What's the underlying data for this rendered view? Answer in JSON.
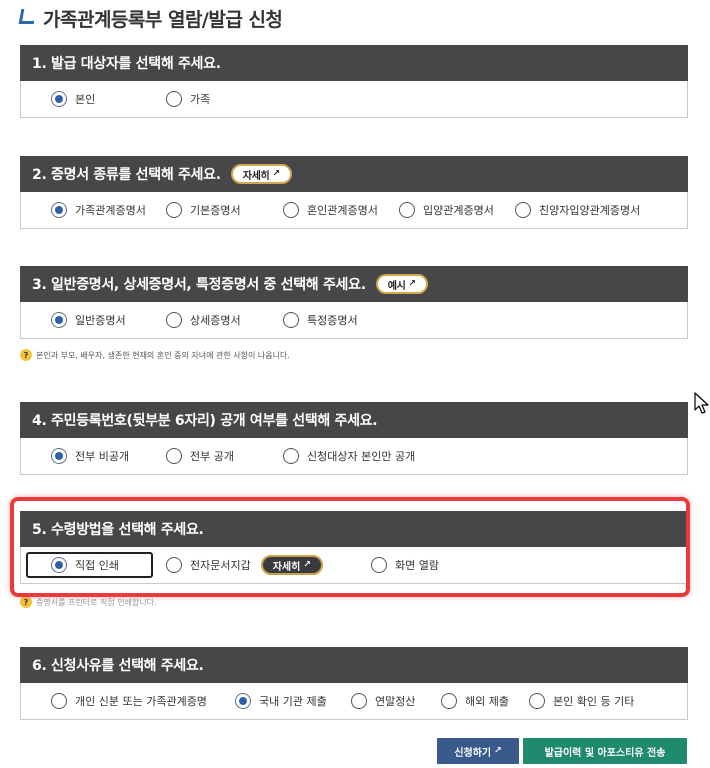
{
  "page": {
    "title": "가족관계등록부 열람/발급 신청"
  },
  "s1": {
    "heading": "1. 발급 대상자를 선택해 주세요.",
    "options": [
      "본인",
      "가족"
    ]
  },
  "s2": {
    "heading": "2. 증명서 종류를 선택해 주세요.",
    "detail_label": "자세히",
    "options": [
      "가족관계증명서",
      "기본증명서",
      "혼인관계증명서",
      "입양관계증명서",
      "친양자입양관계증명서"
    ]
  },
  "s3": {
    "heading": "3. 일반증명서, 상세증명서, 특정증명서 중 선택해 주세요.",
    "example_label": "예시",
    "options": [
      "일반증명서",
      "상세증명서",
      "특정증명서"
    ],
    "note": "본인과 부모, 배우자, 생존한 현재의 혼인 중의 자녀에 관한 사항이 나옵니다."
  },
  "s4": {
    "heading": "4. 주민등록번호(뒷부분 6자리) 공개 여부를 선택해 주세요.",
    "options": [
      "전부 비공개",
      "전부 공개",
      "신청대상자 본인만 공개"
    ]
  },
  "s5": {
    "heading": "5. 수령방법을 선택해 주세요.",
    "options": [
      "직접 인쇄",
      "전자문서지갑",
      "화면 열람"
    ],
    "detail_label": "자세히",
    "note": "증명서를 프린터로 직접 인쇄합니다."
  },
  "s6": {
    "heading": "6. 신청사유를 선택해 주세요.",
    "options": [
      "개인 신분 또는 가족관계증명",
      "국내 기관 제출",
      "연말정산",
      "해외 제출",
      "본인 확인 등 기타"
    ]
  },
  "buttons": {
    "apply": "신청하기",
    "history": "발급이력 및 아포스티유 전송"
  },
  "colors": {
    "header": "#47474a",
    "accent": "#2e5fa8",
    "highlight": "#ec3a3a",
    "apply_btn": "#3a5a8c",
    "history_btn": "#1f8a6e"
  },
  "icons": {
    "external": "external-link-icon",
    "help": "question-icon",
    "cursor": "mouse-cursor-icon"
  }
}
